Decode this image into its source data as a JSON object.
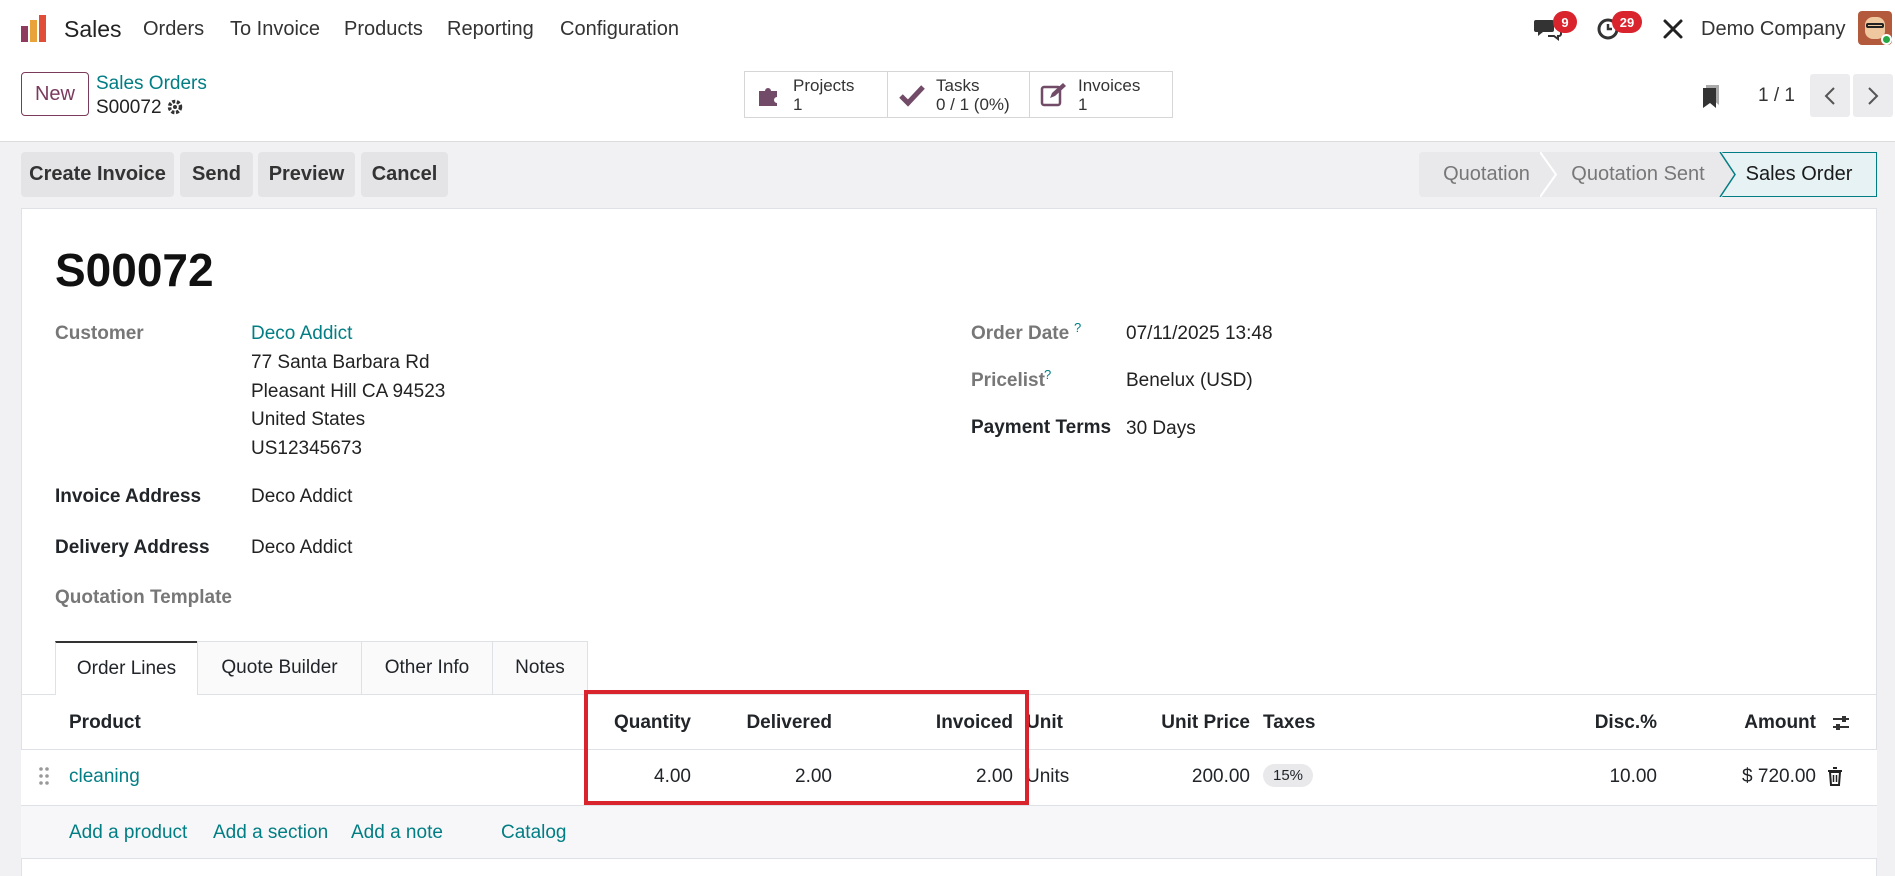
{
  "app": {
    "name": "Sales"
  },
  "nav": {
    "orders": "Orders",
    "to_invoice": "To Invoice",
    "products": "Products",
    "reporting": "Reporting",
    "configuration": "Configuration"
  },
  "systray": {
    "messages_count": "9",
    "activities_count": "29",
    "company": "Demo Company"
  },
  "control": {
    "new_label": "New",
    "breadcrumb_parent": "Sales Orders",
    "breadcrumb_current": "S00072",
    "pager": "1 / 1",
    "smart_buttons": [
      {
        "label": "Projects",
        "value": "1",
        "icon": "puzzle-icon"
      },
      {
        "label": "Tasks",
        "value": "0 / 1 (0%)",
        "icon": "check-icon"
      },
      {
        "label": "Invoices",
        "value": "1",
        "icon": "edit-icon"
      }
    ]
  },
  "actions": {
    "create_invoice": "Create Invoice",
    "send": "Send",
    "preview": "Preview",
    "cancel": "Cancel"
  },
  "statusbar": {
    "quotation": "Quotation",
    "quotation_sent": "Quotation Sent",
    "sales_order": "Sales Order"
  },
  "form": {
    "title": "S00072",
    "customer_label": "Customer",
    "customer_name": "Deco Addict",
    "customer_address": [
      "77 Santa Barbara Rd",
      "Pleasant Hill CA 94523",
      "United States",
      "US12345673"
    ],
    "invoice_address_label": "Invoice Address",
    "invoice_address": "Deco Addict",
    "delivery_address_label": "Delivery Address",
    "delivery_address": "Deco Addict",
    "quotation_template_label": "Quotation Template",
    "order_date_label": "Order Date",
    "order_date": "07/11/2025 13:48",
    "pricelist_label": "Pricelist",
    "pricelist": "Benelux (USD)",
    "payment_terms_label": "Payment Terms",
    "payment_terms": "30 Days",
    "help_mark": "?"
  },
  "tabs": {
    "order_lines": "Order Lines",
    "quote_builder": "Quote Builder",
    "other_info": "Other Info",
    "notes": "Notes"
  },
  "table": {
    "headers": {
      "product": "Product",
      "quantity": "Quantity",
      "delivered": "Delivered",
      "invoiced": "Invoiced",
      "unit": "Unit",
      "unit_price": "Unit Price",
      "taxes": "Taxes",
      "disc": "Disc.%",
      "amount": "Amount"
    },
    "rows": [
      {
        "product": "cleaning",
        "quantity": "4.00",
        "delivered": "2.00",
        "invoiced": "2.00",
        "unit": "Units",
        "unit_price": "200.00",
        "taxes": "15%",
        "disc": "10.00",
        "amount": "$ 720.00"
      }
    ],
    "add_product": "Add a product",
    "add_section": "Add a section",
    "add_note": "Add a note",
    "catalog": "Catalog"
  },
  "colors": {
    "accent": "#017e84",
    "brand": "#714b67",
    "highlight": "#d9232d",
    "badge": "#d9232d"
  }
}
